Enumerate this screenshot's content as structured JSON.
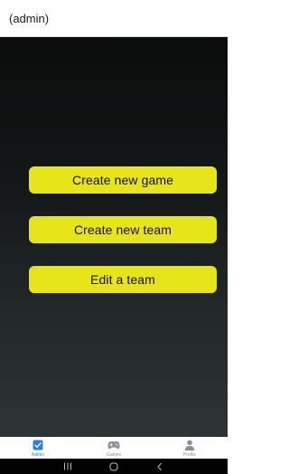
{
  "header": {
    "title": "(admin)"
  },
  "actions": [
    {
      "label": "Create new game"
    },
    {
      "label": "Create new team"
    },
    {
      "label": "Edit a team"
    }
  ],
  "tabs": [
    {
      "label": "Admin",
      "icon": "checkbox-icon",
      "active": true
    },
    {
      "label": "Games",
      "icon": "gamepad-icon",
      "active": false
    },
    {
      "label": "Profile",
      "icon": "person-icon",
      "active": false
    }
  ],
  "colors": {
    "accent_button": "#e6e51a",
    "active_tab": "#2b7de9",
    "inactive_tab": "#8e8e93"
  },
  "system_nav": [
    "recents-icon",
    "home-icon",
    "back-icon"
  ]
}
